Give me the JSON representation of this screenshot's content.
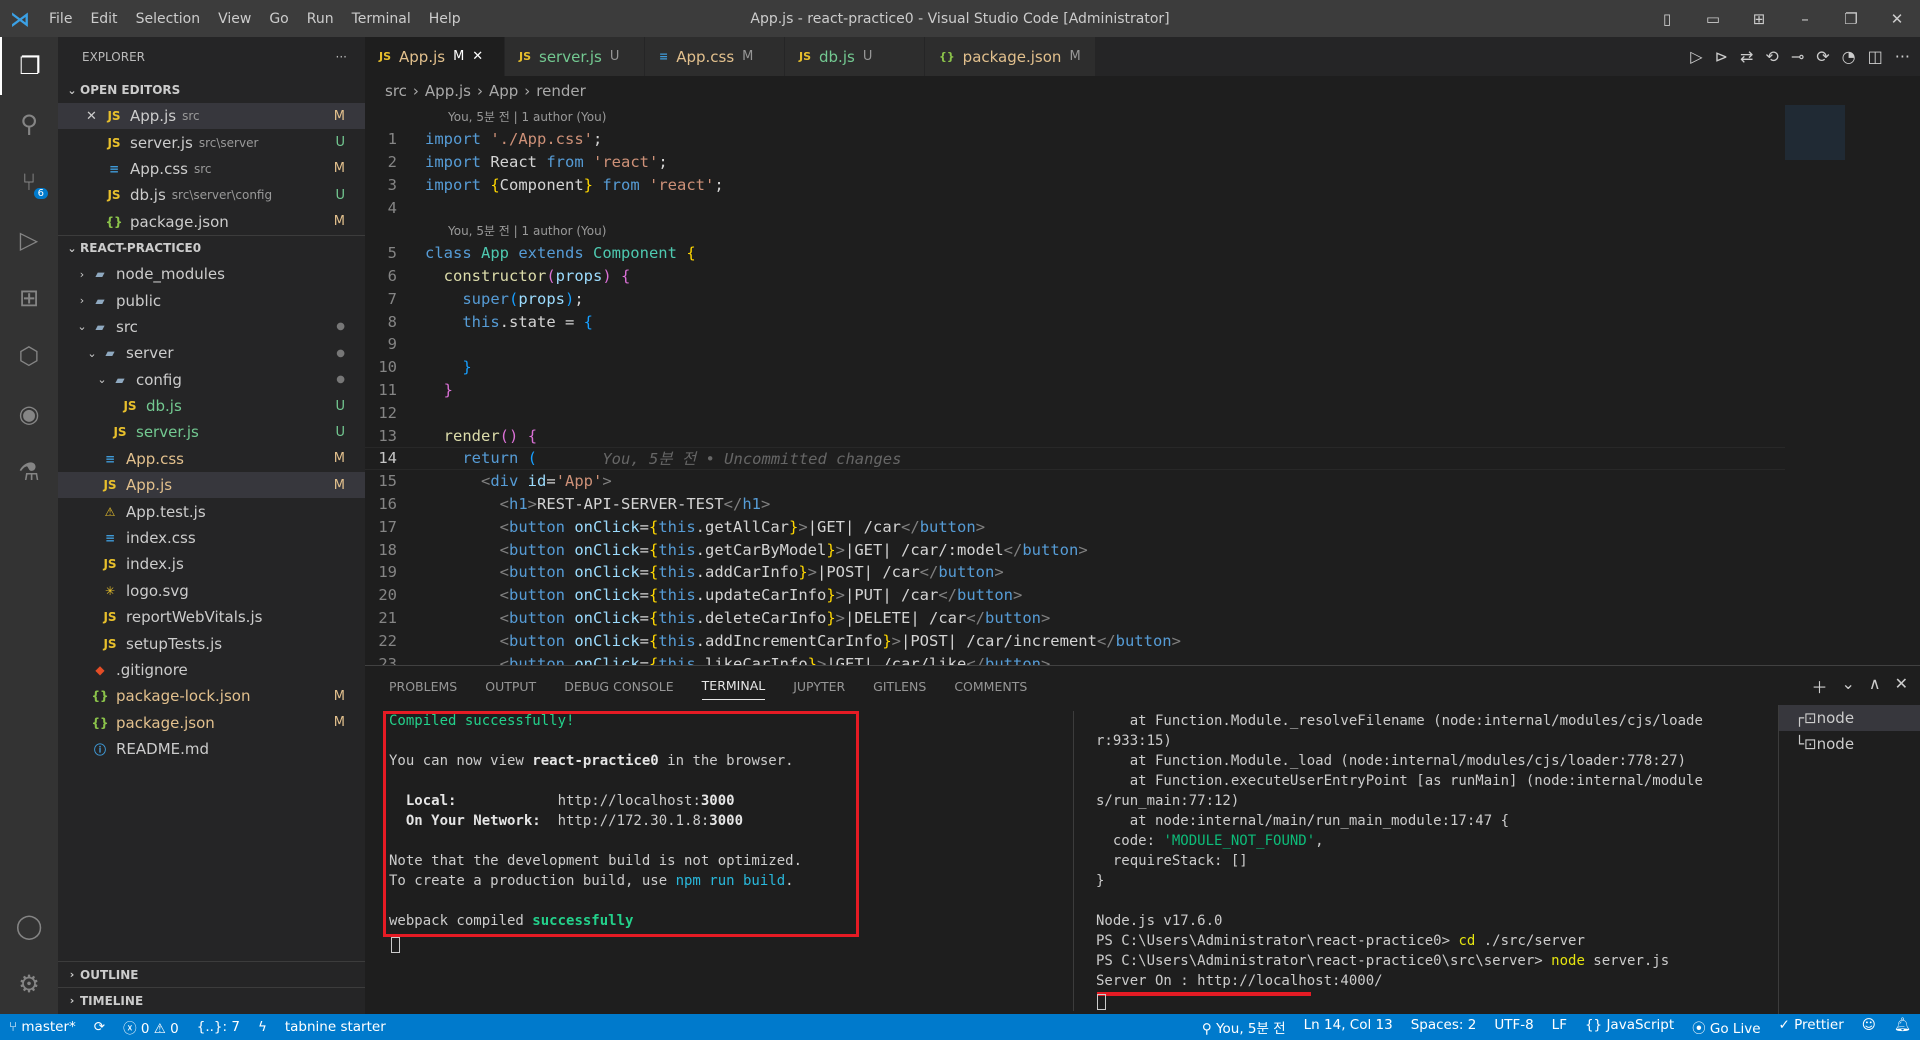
{
  "titlebar": {
    "menus": [
      "File",
      "Edit",
      "Selection",
      "View",
      "Go",
      "Run",
      "Terminal",
      "Help"
    ],
    "title": "App.js - react-practice0 - Visual Studio Code [Administrator]"
  },
  "activity": {
    "items": [
      "explorer-icon",
      "search-icon",
      "source-control-icon",
      "run-debug-icon",
      "extensions-icon",
      "remote-icon",
      "gitlens-icon",
      "testing-icon"
    ],
    "scm_badge": "6",
    "bottom": [
      "account-icon",
      "settings-gear-icon"
    ]
  },
  "sidebar": {
    "title": "EXPLORER",
    "more": "···",
    "open_editors_label": "OPEN EDITORS",
    "project_label": "REACT-PRACTICE0",
    "outline_label": "OUTLINE",
    "timeline_label": "TIMELINE",
    "open_editors": [
      {
        "name": "App.js",
        "desc": "src",
        "status": "M",
        "icon": "js",
        "close": true
      },
      {
        "name": "server.js",
        "desc": "src\\server",
        "status": "U",
        "icon": "js"
      },
      {
        "name": "App.css",
        "desc": "src",
        "status": "M",
        "icon": "css"
      },
      {
        "name": "db.js",
        "desc": "src\\server\\config",
        "status": "U",
        "icon": "js"
      },
      {
        "name": "package.json",
        "desc": "",
        "status": "M",
        "icon": "json"
      }
    ],
    "tree": [
      {
        "name": "node_modules",
        "depth": 1,
        "type": "folder",
        "chev": "›"
      },
      {
        "name": "public",
        "depth": 1,
        "type": "folder",
        "chev": "›"
      },
      {
        "name": "src",
        "depth": 1,
        "type": "folder",
        "chev": "⌄",
        "dot": true
      },
      {
        "name": "server",
        "depth": 2,
        "type": "folder",
        "chev": "⌄",
        "dot": true
      },
      {
        "name": "config",
        "depth": 3,
        "type": "folder",
        "chev": "⌄",
        "dot": true
      },
      {
        "name": "db.js",
        "depth": 4,
        "type": "js",
        "status": "U"
      },
      {
        "name": "server.js",
        "depth": 3,
        "type": "js",
        "status": "U"
      },
      {
        "name": "App.css",
        "depth": 2,
        "type": "css",
        "status": "M"
      },
      {
        "name": "App.js",
        "depth": 2,
        "type": "js",
        "status": "M",
        "selected": true
      },
      {
        "name": "App.test.js",
        "depth": 2,
        "type": "test"
      },
      {
        "name": "index.css",
        "depth": 2,
        "type": "css"
      },
      {
        "name": "index.js",
        "depth": 2,
        "type": "js"
      },
      {
        "name": "logo.svg",
        "depth": 2,
        "type": "svg"
      },
      {
        "name": "reportWebVitals.js",
        "depth": 2,
        "type": "js"
      },
      {
        "name": "setupTests.js",
        "depth": 2,
        "type": "js"
      },
      {
        "name": ".gitignore",
        "depth": 1,
        "type": "git"
      },
      {
        "name": "package-lock.json",
        "depth": 1,
        "type": "json",
        "status": "M"
      },
      {
        "name": "package.json",
        "depth": 1,
        "type": "json",
        "status": "M"
      },
      {
        "name": "README.md",
        "depth": 1,
        "type": "info"
      }
    ]
  },
  "tabs": [
    {
      "name": "App.js",
      "status": "M",
      "icon": "js",
      "active": true
    },
    {
      "name": "server.js",
      "status": "U",
      "icon": "js"
    },
    {
      "name": "App.css",
      "status": "M",
      "icon": "css"
    },
    {
      "name": "db.js",
      "status": "U",
      "icon": "js"
    },
    {
      "name": "package.json",
      "status": "M",
      "icon": "json"
    }
  ],
  "breadcrumb": [
    "src",
    "App.js",
    "App",
    "render"
  ],
  "editor": {
    "lens": "You, 5분 전 | 1 author (You)",
    "current_line": 14,
    "lines": [
      {
        "n": 1,
        "t": [
          [
            "kw",
            "import "
          ],
          [
            "str",
            "'./App.css'"
          ],
          [
            "id",
            ";"
          ]
        ]
      },
      {
        "n": 2,
        "t": [
          [
            "kw",
            "import "
          ],
          [
            "id",
            "React "
          ],
          [
            "kw",
            "from "
          ],
          [
            "str",
            "'react'"
          ],
          [
            "id",
            ";"
          ]
        ]
      },
      {
        "n": 3,
        "t": [
          [
            "kw",
            "import "
          ],
          [
            "br1",
            "{"
          ],
          [
            "id",
            "Component"
          ],
          [
            "br1",
            "}"
          ],
          [
            "kw",
            " from "
          ],
          [
            "str",
            "'react'"
          ],
          [
            "id",
            ";"
          ]
        ]
      },
      {
        "n": 4,
        "t": []
      },
      {
        "n": 5,
        "lens": true,
        "t": [
          [
            "kw",
            "class "
          ],
          [
            "ty",
            "App "
          ],
          [
            "kw",
            "extends "
          ],
          [
            "ty",
            "Component "
          ],
          [
            "br1",
            "{"
          ]
        ]
      },
      {
        "n": 6,
        "t": [
          [
            "id",
            "  "
          ],
          [
            "fn",
            "constructor"
          ],
          [
            "br2",
            "("
          ],
          [
            "at",
            "props"
          ],
          [
            "br2",
            ")"
          ],
          [
            "id",
            " "
          ],
          [
            "br2",
            "{"
          ]
        ]
      },
      {
        "n": 7,
        "t": [
          [
            "id",
            "    "
          ],
          [
            "kw",
            "super"
          ],
          [
            "br3",
            "("
          ],
          [
            "at",
            "props"
          ],
          [
            "br3",
            ")"
          ],
          [
            "id",
            ";"
          ]
        ]
      },
      {
        "n": 8,
        "t": [
          [
            "id",
            "    "
          ],
          [
            "kw",
            "this"
          ],
          [
            "id",
            ".state = "
          ],
          [
            "br3",
            "{"
          ]
        ]
      },
      {
        "n": 9,
        "t": []
      },
      {
        "n": 10,
        "t": [
          [
            "id",
            "    "
          ],
          [
            "br3",
            "}"
          ]
        ]
      },
      {
        "n": 11,
        "t": [
          [
            "id",
            "  "
          ],
          [
            "br2",
            "}"
          ]
        ]
      },
      {
        "n": 12,
        "t": []
      },
      {
        "n": 13,
        "t": [
          [
            "id",
            "  "
          ],
          [
            "fn",
            "render"
          ],
          [
            "br2",
            "()"
          ],
          [
            "id",
            " "
          ],
          [
            "br2",
            "{"
          ]
        ]
      },
      {
        "n": 14,
        "t": [
          [
            "id",
            "    "
          ],
          [
            "kw",
            "return "
          ],
          [
            "br3",
            "("
          ],
          [
            "gh",
            "       You, 5분 전 • Uncommitted changes"
          ]
        ]
      },
      {
        "n": 15,
        "t": [
          [
            "id",
            "      "
          ],
          [
            "tg",
            "<"
          ],
          [
            "tn",
            "div "
          ],
          [
            "at",
            "id"
          ],
          [
            "id",
            "="
          ],
          [
            "str",
            "'App'"
          ],
          [
            "tg",
            ">"
          ]
        ]
      },
      {
        "n": 16,
        "t": [
          [
            "id",
            "        "
          ],
          [
            "tg",
            "<"
          ],
          [
            "tn",
            "h1"
          ],
          [
            "tg",
            ">"
          ],
          [
            "id",
            "REST-API-SERVER-TEST"
          ],
          [
            "tg",
            "</"
          ],
          [
            "tn",
            "h1"
          ],
          [
            "tg",
            ">"
          ]
        ]
      },
      {
        "n": 17,
        "t": [
          [
            "id",
            "        "
          ],
          [
            "tg",
            "<"
          ],
          [
            "tn",
            "button "
          ],
          [
            "at",
            "onClick"
          ],
          [
            "id",
            "="
          ],
          [
            "br1",
            "{"
          ],
          [
            "kw",
            "this"
          ],
          [
            "id",
            ".getAllCar"
          ],
          [
            "br1",
            "}"
          ],
          [
            "tg",
            ">"
          ],
          [
            "id",
            "|GET| /car"
          ],
          [
            "tg",
            "</"
          ],
          [
            "tn",
            "button"
          ],
          [
            "tg",
            ">"
          ]
        ]
      },
      {
        "n": 18,
        "t": [
          [
            "id",
            "        "
          ],
          [
            "tg",
            "<"
          ],
          [
            "tn",
            "button "
          ],
          [
            "at",
            "onClick"
          ],
          [
            "id",
            "="
          ],
          [
            "br1",
            "{"
          ],
          [
            "kw",
            "this"
          ],
          [
            "id",
            ".getCarByModel"
          ],
          [
            "br1",
            "}"
          ],
          [
            "tg",
            ">"
          ],
          [
            "id",
            "|GET| /car/:model"
          ],
          [
            "tg",
            "</"
          ],
          [
            "tn",
            "button"
          ],
          [
            "tg",
            ">"
          ]
        ]
      },
      {
        "n": 19,
        "t": [
          [
            "id",
            "        "
          ],
          [
            "tg",
            "<"
          ],
          [
            "tn",
            "button "
          ],
          [
            "at",
            "onClick"
          ],
          [
            "id",
            "="
          ],
          [
            "br1",
            "{"
          ],
          [
            "kw",
            "this"
          ],
          [
            "id",
            ".addCarInfo"
          ],
          [
            "br1",
            "}"
          ],
          [
            "tg",
            ">"
          ],
          [
            "id",
            "|POST| /car"
          ],
          [
            "tg",
            "</"
          ],
          [
            "tn",
            "button"
          ],
          [
            "tg",
            ">"
          ]
        ]
      },
      {
        "n": 20,
        "t": [
          [
            "id",
            "        "
          ],
          [
            "tg",
            "<"
          ],
          [
            "tn",
            "button "
          ],
          [
            "at",
            "onClick"
          ],
          [
            "id",
            "="
          ],
          [
            "br1",
            "{"
          ],
          [
            "kw",
            "this"
          ],
          [
            "id",
            ".updateCarInfo"
          ],
          [
            "br1",
            "}"
          ],
          [
            "tg",
            ">"
          ],
          [
            "id",
            "|PUT| /car"
          ],
          [
            "tg",
            "</"
          ],
          [
            "tn",
            "button"
          ],
          [
            "tg",
            ">"
          ]
        ]
      },
      {
        "n": 21,
        "t": [
          [
            "id",
            "        "
          ],
          [
            "tg",
            "<"
          ],
          [
            "tn",
            "button "
          ],
          [
            "at",
            "onClick"
          ],
          [
            "id",
            "="
          ],
          [
            "br1",
            "{"
          ],
          [
            "kw",
            "this"
          ],
          [
            "id",
            ".deleteCarInfo"
          ],
          [
            "br1",
            "}"
          ],
          [
            "tg",
            ">"
          ],
          [
            "id",
            "|DELETE| /car"
          ],
          [
            "tg",
            "</"
          ],
          [
            "tn",
            "button"
          ],
          [
            "tg",
            ">"
          ]
        ]
      },
      {
        "n": 22,
        "t": [
          [
            "id",
            "        "
          ],
          [
            "tg",
            "<"
          ],
          [
            "tn",
            "button "
          ],
          [
            "at",
            "onClick"
          ],
          [
            "id",
            "="
          ],
          [
            "br1",
            "{"
          ],
          [
            "kw",
            "this"
          ],
          [
            "id",
            ".addIncrementCarInfo"
          ],
          [
            "br1",
            "}"
          ],
          [
            "tg",
            ">"
          ],
          [
            "id",
            "|POST| /car/increment"
          ],
          [
            "tg",
            "</"
          ],
          [
            "tn",
            "button"
          ],
          [
            "tg",
            ">"
          ]
        ]
      },
      {
        "n": 23,
        "t": [
          [
            "id",
            "        "
          ],
          [
            "tg",
            "<"
          ],
          [
            "tn",
            "button "
          ],
          [
            "at",
            "onClick"
          ],
          [
            "id",
            "="
          ],
          [
            "br1",
            "{"
          ],
          [
            "kw",
            "this"
          ],
          [
            "id",
            ".likeCarInfo"
          ],
          [
            "br1",
            "}"
          ],
          [
            "tg",
            ">"
          ],
          [
            "id",
            "|GET| /car/like"
          ],
          [
            "tg",
            "</"
          ],
          [
            "tn",
            "button"
          ],
          [
            "tg",
            ">"
          ]
        ]
      }
    ]
  },
  "panel": {
    "tabs": [
      "PROBLEMS",
      "OUTPUT",
      "DEBUG CONSOLE",
      "TERMINAL",
      "JUPYTER",
      "GITLENS",
      "COMMENTS"
    ],
    "active_tab": "TERMINAL",
    "terminal_left": [
      [
        [
          "g",
          "Compiled successfully!"
        ]
      ],
      [],
      [
        [
          "",
          "You can now view "
        ],
        [
          "b",
          "react-practice0"
        ],
        [
          "",
          " in the browser."
        ]
      ],
      [],
      [
        [
          "b",
          "  Local:            "
        ],
        [
          "",
          "http://localhost:"
        ],
        [
          "b",
          "3000"
        ]
      ],
      [
        [
          "b",
          "  On Your Network:  "
        ],
        [
          "",
          "http://172.30.1.8:"
        ],
        [
          "b",
          "3000"
        ]
      ],
      [],
      [
        [
          "",
          "Note that the development build is not optimized."
        ]
      ],
      [
        [
          "",
          "To create a production build, use "
        ],
        [
          "cy",
          "npm run build"
        ],
        [
          "",
          "."
        ]
      ],
      [],
      [
        [
          "",
          "webpack compiled "
        ],
        [
          "gb",
          "successfully"
        ]
      ]
    ],
    "terminal_right": [
      [
        [
          "",
          "    at Function.Module._resolveFilename (node:internal/modules/cjs/loade"
        ]
      ],
      [
        [
          "",
          "r:933:15)"
        ]
      ],
      [
        [
          "",
          "    at Function.Module._load (node:internal/modules/cjs/loader:778:27)"
        ]
      ],
      [
        [
          "",
          "    at Function.executeUserEntryPoint [as runMain] (node:internal/module"
        ]
      ],
      [
        [
          "",
          "s/run_main:77:12)"
        ]
      ],
      [
        [
          "",
          "    at node:internal/main/run_main_module:17:47 {"
        ]
      ],
      [
        [
          "",
          "  code: "
        ],
        [
          "gs",
          "'MODULE_NOT_FOUND'"
        ],
        [
          "",
          ","
        ]
      ],
      [
        [
          "",
          "  requireStack: []"
        ]
      ],
      [
        [
          "",
          "}"
        ]
      ],
      [],
      [
        [
          "",
          "Node.js v17.6.0"
        ]
      ],
      [
        [
          "",
          "PS C:\\Users\\Administrator\\react-practice0> "
        ],
        [
          "y",
          "cd"
        ],
        [
          "",
          " ./src/server"
        ]
      ],
      [
        [
          "",
          "PS C:\\Users\\Administrator\\react-practice0\\src\\server> "
        ],
        [
          "y",
          "node"
        ],
        [
          "",
          " server.js"
        ]
      ],
      [
        [
          "",
          "Server On : http://localhost:4000/"
        ]
      ]
    ],
    "terminals": [
      "node",
      "node"
    ]
  },
  "status": {
    "branch": "master*",
    "errors": "0",
    "warnings": "0",
    "braces": "{..}: 7",
    "tabnine": "tabnine starter",
    "blame": "You, 5분 전",
    "position": "Ln 14, Col 13",
    "spaces": "Spaces: 2",
    "encoding": "UTF-8",
    "eol": "LF",
    "language": "JavaScript",
    "golive": "Go Live",
    "prettier": "Prettier"
  },
  "colors": {
    "accent": "#007acc",
    "highlight": "#e51b24",
    "js": "#e8c02c",
    "css": "#3f9bd9",
    "json": "#8bc34a"
  }
}
